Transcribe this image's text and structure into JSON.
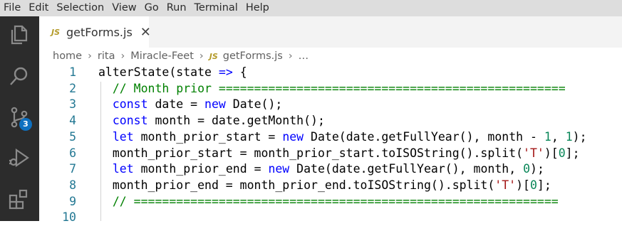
{
  "menu": [
    "File",
    "Edit",
    "Selection",
    "View",
    "Go",
    "Run",
    "Terminal",
    "Help"
  ],
  "activity_bar": {
    "icons": [
      "explorer-icon",
      "search-icon",
      "source-control-icon",
      "run-debug-icon",
      "extensions-icon"
    ],
    "source_control_badge": "3",
    "background": "#2c2c2c",
    "badge_color": "#0e70c0"
  },
  "tab": {
    "file_icon": "JS",
    "label": "getForms.js",
    "close": "✕"
  },
  "breadcrumb": {
    "items": [
      "home",
      "rita",
      "Miracle-Feet"
    ],
    "file_icon": "JS",
    "file": "getForms.js",
    "ellipsis": "…",
    "separator": "›"
  },
  "editor": {
    "line_numbers": [
      "1",
      "2",
      "3",
      "4",
      "5",
      "6",
      "7",
      "8",
      "9",
      "10"
    ],
    "lines": [
      [
        {
          "t": "alterState(state "
        },
        {
          "t": "=>",
          "c": "kw"
        },
        {
          "t": " {"
        }
      ],
      [
        {
          "t": "  "
        },
        {
          "t": "// Month prior =================================================",
          "c": "cm"
        }
      ],
      [
        {
          "t": "  "
        },
        {
          "t": "const",
          "c": "kw"
        },
        {
          "t": " date = "
        },
        {
          "t": "new",
          "c": "kw"
        },
        {
          "t": " Date();"
        }
      ],
      [
        {
          "t": "  "
        },
        {
          "t": "const",
          "c": "kw"
        },
        {
          "t": " month = date.getMonth();"
        }
      ],
      [
        {
          "t": "  "
        },
        {
          "t": "let",
          "c": "kw"
        },
        {
          "t": " month_prior_start = "
        },
        {
          "t": "new",
          "c": "kw"
        },
        {
          "t": " Date(date.getFullYear(), month - "
        },
        {
          "t": "1",
          "c": "num"
        },
        {
          "t": ", "
        },
        {
          "t": "1",
          "c": "num"
        },
        {
          "t": ");"
        }
      ],
      [
        {
          "t": "  month_prior_start = month_prior_start.toISOString().split("
        },
        {
          "t": "'T'",
          "c": "str"
        },
        {
          "t": ")["
        },
        {
          "t": "0",
          "c": "num"
        },
        {
          "t": "];"
        }
      ],
      [
        {
          "t": "  "
        },
        {
          "t": "let",
          "c": "kw"
        },
        {
          "t": " month_prior_end = "
        },
        {
          "t": "new",
          "c": "kw"
        },
        {
          "t": " Date(date.getFullYear(), month, "
        },
        {
          "t": "0",
          "c": "num"
        },
        {
          "t": ");"
        }
      ],
      [
        {
          "t": "  month_prior_end = month_prior_end.toISOString().split("
        },
        {
          "t": "'T'",
          "c": "str"
        },
        {
          "t": ")["
        },
        {
          "t": "0",
          "c": "num"
        },
        {
          "t": "];"
        }
      ],
      [
        {
          "t": "  "
        },
        {
          "t": "// ============================================================",
          "c": "cm"
        }
      ],
      [
        {
          "t": ""
        }
      ]
    ]
  },
  "colors": {
    "keyword": "#0000ff",
    "comment": "#008000",
    "number": "#098658",
    "string": "#a31515",
    "line_number": "#237893"
  }
}
